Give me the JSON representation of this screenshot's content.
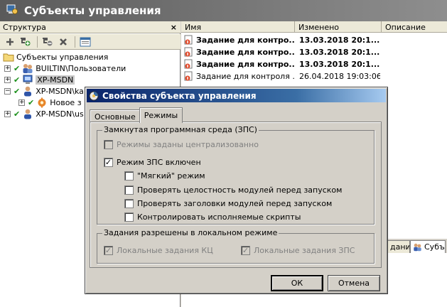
{
  "window": {
    "title": "Субъекты управления"
  },
  "structure_panel": {
    "title": "Структура",
    "close_label": "×",
    "toolbar": [
      "add-icon",
      "add-rule-icon",
      "delete-rule-icon",
      "delete-icon",
      "folder-icon"
    ],
    "tree": [
      {
        "label": "Субъекты управления",
        "level": 0,
        "expander": "",
        "check": false,
        "icon": "folder-icon"
      },
      {
        "label": "BUILTIN\\Пользователи",
        "level": 1,
        "expander": "+",
        "check": true,
        "icon": "users-icon"
      },
      {
        "label": "XP-MSDN",
        "level": 1,
        "expander": "+",
        "check": true,
        "icon": "computer-icon",
        "selected": true
      },
      {
        "label": "XP-MSDN\\ka",
        "level": 1,
        "expander": "−",
        "check": true,
        "icon": "user-icon"
      },
      {
        "label": "Новое з",
        "level": 2,
        "expander": "+",
        "check": true,
        "icon": "gear-icon"
      },
      {
        "label": "XP-MSDN\\us",
        "level": 1,
        "expander": "+",
        "check": true,
        "icon": "user-icon"
      }
    ]
  },
  "task_list": {
    "columns": [
      "Имя",
      "Изменено",
      "Описание"
    ],
    "rows": [
      {
        "name": "Задание для контро...",
        "modified": "13.03.2018   20:1...",
        "bold": true
      },
      {
        "name": "Задание для контро...",
        "modified": "13.03.2018   20:1...",
        "bold": true
      },
      {
        "name": "Задание для контро...",
        "modified": "13.03.2018   20:1...",
        "bold": true
      },
      {
        "name": "Задание для контроля ...",
        "modified": "26.04.2018   19:03:06",
        "bold": false
      }
    ]
  },
  "bottom_tabs": {
    "items": [
      "дания",
      "Субъ"
    ]
  },
  "dialog": {
    "title": "Свойства субъекта управления",
    "tabs": [
      {
        "label": "Основные",
        "active": false
      },
      {
        "label": "Режимы",
        "active": true
      }
    ],
    "group_zps": {
      "legend": "Замкнутая программная среда (ЗПС)",
      "options": [
        {
          "label": "Режимы заданы централизованно",
          "checked": false,
          "disabled": true,
          "indent": 0
        },
        {
          "label": "Режим ЗПС включен",
          "checked": true,
          "disabled": false,
          "indent": 0
        },
        {
          "label": "\"Мягкий\" режим",
          "checked": false,
          "disabled": false,
          "indent": 1
        },
        {
          "label": "Проверять целостность модулей перед запуском",
          "checked": false,
          "disabled": false,
          "indent": 1
        },
        {
          "label": "Проверять заголовки модулей перед запуском",
          "checked": false,
          "disabled": false,
          "indent": 1
        },
        {
          "label": "Контролировать исполняемые скрипты",
          "checked": false,
          "disabled": false,
          "indent": 1
        }
      ]
    },
    "group_local": {
      "legend": "Задания разрешены в локальном режиме",
      "options": [
        {
          "label": "Локальные задания КЦ",
          "checked": true,
          "disabled": true
        },
        {
          "label": "Локальные задания ЗПС",
          "checked": true,
          "disabled": true
        }
      ]
    },
    "ok_label": "ОК",
    "cancel_label": "Отмена"
  }
}
